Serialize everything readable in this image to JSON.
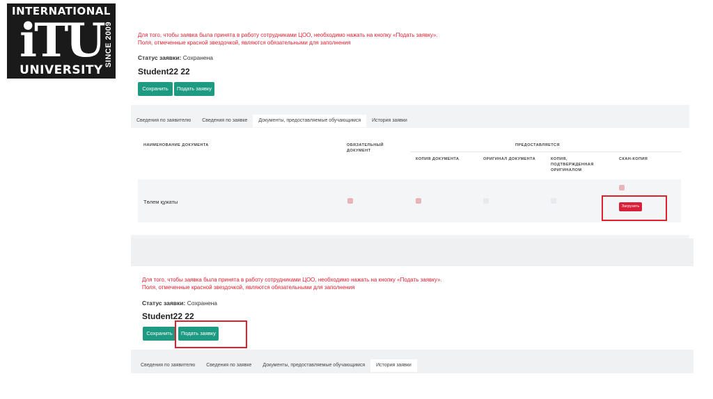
{
  "logo": {
    "line1": "INTERNATIONAL",
    "mark": "iTU",
    "since": "SINCE 2009",
    "line3": "UNIVERSITY"
  },
  "form": {
    "notice_line1": "Для того, чтобы заявка была принята в работу сотрудниками ЦОО, необходимо нажать на кнопку «Подать заявку».",
    "notice_line2": "Поля, отмеченные красной звездочкой, являются обязательными для заполнения",
    "status_label": "Статус заявки:",
    "status_value": "Сохранена",
    "student_name": "Student22 22",
    "save_label": "Сохранить",
    "submit_label": "Подать заявку"
  },
  "tabs": [
    "Сведения по заявителю",
    "Сведения по заявке",
    "Документы, предоставляемые обучающимся",
    "История заявки"
  ],
  "table": {
    "headers": {
      "name": "НАИМЕНОВАНИЕ ДОКУМЕНТА",
      "required": "ОБЯЗАТЕЛЬНЫЙ ДОКУМЕНТ",
      "provided": "ПРЕДОСТАВЛЯЕТСЯ",
      "copy": "КОПИЯ ДОКУМЕНТА",
      "original": "ОРИГИНАЛ ДОКУМЕНТА",
      "certified": "КОПИЯ, ПОДТВЕРЖДЕННАЯ ОРИГИНАЛОМ",
      "scan": "СКАН-КОПИЯ"
    },
    "rows": [
      {
        "name": "Төлем құжаты",
        "required": true,
        "copy": true,
        "original": false,
        "certified": false,
        "scan": true
      }
    ],
    "upload_label": "Загрузить"
  },
  "colors": {
    "accent_green": "#1e9a83",
    "alert_red": "#e0202e",
    "upload_red": "#d9203a"
  }
}
